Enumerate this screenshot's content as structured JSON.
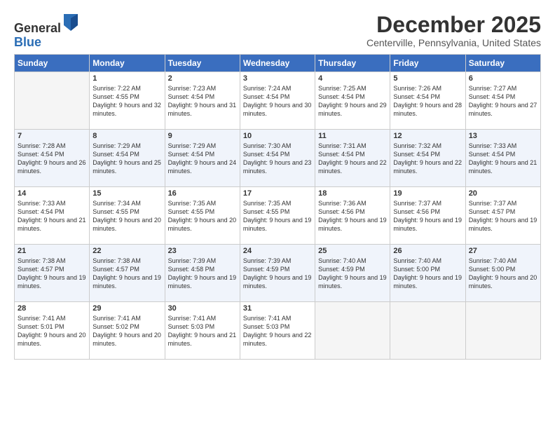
{
  "header": {
    "logo_general": "General",
    "logo_blue": "Blue",
    "month": "December 2025",
    "location": "Centerville, Pennsylvania, United States"
  },
  "weekdays": [
    "Sunday",
    "Monday",
    "Tuesday",
    "Wednesday",
    "Thursday",
    "Friday",
    "Saturday"
  ],
  "weeks": [
    [
      {
        "day": "",
        "empty": true
      },
      {
        "day": "1",
        "sunrise": "7:22 AM",
        "sunset": "4:55 PM",
        "daylight": "9 hours and 32 minutes."
      },
      {
        "day": "2",
        "sunrise": "7:23 AM",
        "sunset": "4:54 PM",
        "daylight": "9 hours and 31 minutes."
      },
      {
        "day": "3",
        "sunrise": "7:24 AM",
        "sunset": "4:54 PM",
        "daylight": "9 hours and 30 minutes."
      },
      {
        "day": "4",
        "sunrise": "7:25 AM",
        "sunset": "4:54 PM",
        "daylight": "9 hours and 29 minutes."
      },
      {
        "day": "5",
        "sunrise": "7:26 AM",
        "sunset": "4:54 PM",
        "daylight": "9 hours and 28 minutes."
      },
      {
        "day": "6",
        "sunrise": "7:27 AM",
        "sunset": "4:54 PM",
        "daylight": "9 hours and 27 minutes."
      }
    ],
    [
      {
        "day": "7",
        "sunrise": "7:28 AM",
        "sunset": "4:54 PM",
        "daylight": "9 hours and 26 minutes."
      },
      {
        "day": "8",
        "sunrise": "7:29 AM",
        "sunset": "4:54 PM",
        "daylight": "9 hours and 25 minutes."
      },
      {
        "day": "9",
        "sunrise": "7:29 AM",
        "sunset": "4:54 PM",
        "daylight": "9 hours and 24 minutes."
      },
      {
        "day": "10",
        "sunrise": "7:30 AM",
        "sunset": "4:54 PM",
        "daylight": "9 hours and 23 minutes."
      },
      {
        "day": "11",
        "sunrise": "7:31 AM",
        "sunset": "4:54 PM",
        "daylight": "9 hours and 22 minutes."
      },
      {
        "day": "12",
        "sunrise": "7:32 AM",
        "sunset": "4:54 PM",
        "daylight": "9 hours and 22 minutes."
      },
      {
        "day": "13",
        "sunrise": "7:33 AM",
        "sunset": "4:54 PM",
        "daylight": "9 hours and 21 minutes."
      }
    ],
    [
      {
        "day": "14",
        "sunrise": "7:33 AM",
        "sunset": "4:54 PM",
        "daylight": "9 hours and 21 minutes."
      },
      {
        "day": "15",
        "sunrise": "7:34 AM",
        "sunset": "4:55 PM",
        "daylight": "9 hours and 20 minutes."
      },
      {
        "day": "16",
        "sunrise": "7:35 AM",
        "sunset": "4:55 PM",
        "daylight": "9 hours and 20 minutes."
      },
      {
        "day": "17",
        "sunrise": "7:35 AM",
        "sunset": "4:55 PM",
        "daylight": "9 hours and 19 minutes."
      },
      {
        "day": "18",
        "sunrise": "7:36 AM",
        "sunset": "4:56 PM",
        "daylight": "9 hours and 19 minutes."
      },
      {
        "day": "19",
        "sunrise": "7:37 AM",
        "sunset": "4:56 PM",
        "daylight": "9 hours and 19 minutes."
      },
      {
        "day": "20",
        "sunrise": "7:37 AM",
        "sunset": "4:57 PM",
        "daylight": "9 hours and 19 minutes."
      }
    ],
    [
      {
        "day": "21",
        "sunrise": "7:38 AM",
        "sunset": "4:57 PM",
        "daylight": "9 hours and 19 minutes."
      },
      {
        "day": "22",
        "sunrise": "7:38 AM",
        "sunset": "4:57 PM",
        "daylight": "9 hours and 19 minutes."
      },
      {
        "day": "23",
        "sunrise": "7:39 AM",
        "sunset": "4:58 PM",
        "daylight": "9 hours and 19 minutes."
      },
      {
        "day": "24",
        "sunrise": "7:39 AM",
        "sunset": "4:59 PM",
        "daylight": "9 hours and 19 minutes."
      },
      {
        "day": "25",
        "sunrise": "7:40 AM",
        "sunset": "4:59 PM",
        "daylight": "9 hours and 19 minutes."
      },
      {
        "day": "26",
        "sunrise": "7:40 AM",
        "sunset": "5:00 PM",
        "daylight": "9 hours and 19 minutes."
      },
      {
        "day": "27",
        "sunrise": "7:40 AM",
        "sunset": "5:00 PM",
        "daylight": "9 hours and 20 minutes."
      }
    ],
    [
      {
        "day": "28",
        "sunrise": "7:41 AM",
        "sunset": "5:01 PM",
        "daylight": "9 hours and 20 minutes."
      },
      {
        "day": "29",
        "sunrise": "7:41 AM",
        "sunset": "5:02 PM",
        "daylight": "9 hours and 20 minutes."
      },
      {
        "day": "30",
        "sunrise": "7:41 AM",
        "sunset": "5:03 PM",
        "daylight": "9 hours and 21 minutes."
      },
      {
        "day": "31",
        "sunrise": "7:41 AM",
        "sunset": "5:03 PM",
        "daylight": "9 hours and 22 minutes."
      },
      {
        "day": "",
        "empty": true
      },
      {
        "day": "",
        "empty": true
      },
      {
        "day": "",
        "empty": true
      }
    ]
  ]
}
